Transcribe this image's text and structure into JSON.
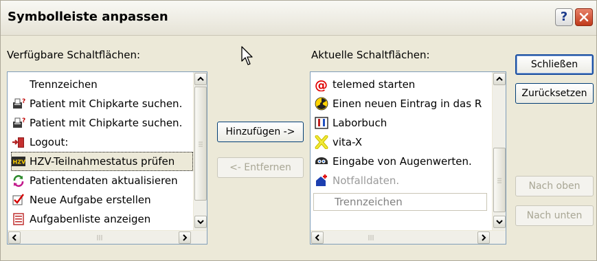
{
  "dialog": {
    "title": "Symbolleiste anpassen",
    "help_symbol": "?"
  },
  "available": {
    "label": "Verfügbare Schaltflächen:",
    "items": [
      {
        "label": "Trennzeichen",
        "icon": "none"
      },
      {
        "label": "Patient mit Chipkarte suchen.",
        "icon": "card-reader-icon"
      },
      {
        "label": "Patient mit Chipkarte suchen.",
        "icon": "card-reader-icon"
      },
      {
        "label": "Logout:",
        "icon": "logout-door-icon"
      },
      {
        "label": "HZV-Teilnahmestatus prüfen",
        "icon": "hzv-icon",
        "selected": true
      },
      {
        "label": "Patientendaten aktualisieren",
        "icon": "refresh-arrows-icon"
      },
      {
        "label": "Neue Aufgabe erstellen",
        "icon": "checkbox-icon"
      },
      {
        "label": "Aufgabenliste anzeigen",
        "icon": "task-list-icon"
      }
    ]
  },
  "current": {
    "label": "Aktuelle Schaltflächen:",
    "items": [
      {
        "label": "telemed starten",
        "icon": "at-sign-icon"
      },
      {
        "label": "Einen neuen Eintrag in das R",
        "icon": "radiation-icon"
      },
      {
        "label": "Laborbuch",
        "icon": "lab-book-icon"
      },
      {
        "label": "vita-X",
        "icon": "vita-x-icon"
      },
      {
        "label": "Eingabe von Augenwerten.",
        "icon": "eye-values-icon"
      },
      {
        "label": "Notfalldaten.",
        "icon": "emergency-icon",
        "disabled": true
      },
      {
        "label": "Trennzeichen",
        "icon": "none",
        "separator_box": true
      }
    ]
  },
  "buttons": {
    "add": "Hinzufügen ->",
    "remove": "<- Entfernen",
    "close": "Schließen",
    "reset": "Zurücksetzen",
    "move_up": "Nach oben",
    "move_down": "Nach unten"
  },
  "colors": {
    "face": "#ece9d8",
    "list_border": "#7f9db9",
    "default_button_border": "#1b4fa0",
    "disabled_text": "#9a9a9a"
  }
}
